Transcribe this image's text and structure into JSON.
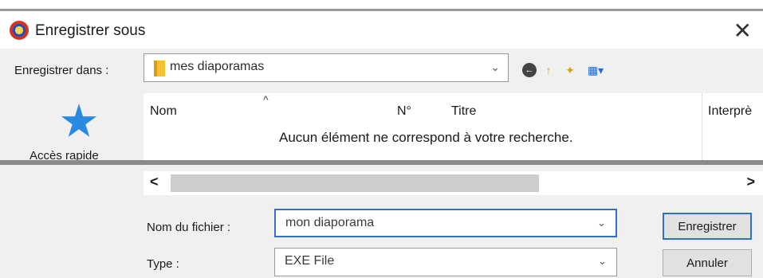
{
  "window": {
    "title": "Enregistrer sous",
    "close_glyph": "✕"
  },
  "save_in": {
    "label": "Enregistrer dans :",
    "folder": "mes diaporamas"
  },
  "toolbar": {
    "back_icon": "back-icon",
    "up_icon": "up-folder-icon",
    "new_icon": "new-folder-icon",
    "view_icon": "view-menu-icon"
  },
  "quick_access": {
    "label": "Accès rapide"
  },
  "list": {
    "columns": [
      "Nom",
      "N°",
      "Titre",
      "Interprè"
    ],
    "empty_message": "Aucun élément ne correspond à votre recherche."
  },
  "scrollbar": {
    "left_glyph": "<",
    "right_glyph": ">"
  },
  "filename": {
    "label": "Nom du fichier :",
    "value": "mon diaporama"
  },
  "type": {
    "label": "Type :",
    "value": "EXE File"
  },
  "buttons": {
    "save": "Enregistrer",
    "cancel": "Annuler"
  },
  "colors": {
    "accent": "#2f72c4",
    "panel": "#f0f0f0"
  }
}
